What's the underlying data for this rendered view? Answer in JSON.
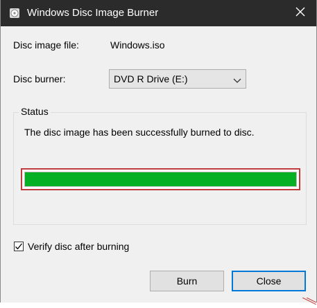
{
  "window": {
    "title": "Windows Disc Image Burner",
    "title_icon": "disc-burner-app-icon",
    "close_icon": "close-icon",
    "titlebar_color": "#2b2b2b"
  },
  "form": {
    "image_file_label": "Disc image file:",
    "image_file_value": "Windows.iso",
    "burner_label": "Disc burner:",
    "burner_selected": "DVD R Drive (E:)",
    "dropdown_icon": "chevron-down-icon"
  },
  "status": {
    "group_title": "Status",
    "message": "The disc image has been successfully burned to disc.",
    "progress_percent": 100,
    "progress_color": "#06b025",
    "highlight_color": "#c0393b"
  },
  "options": {
    "verify_label": "Verify disc after burning",
    "verify_checked": true
  },
  "buttons": {
    "burn_label": "Burn",
    "close_label": "Close",
    "default_border_color": "#0078d7"
  }
}
